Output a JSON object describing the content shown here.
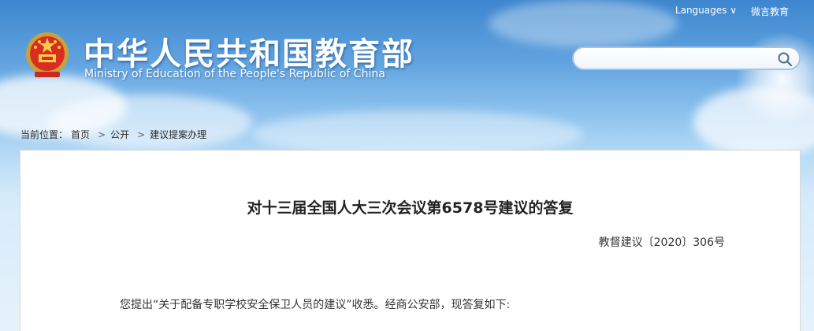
{
  "topbar": {
    "languages": "Languages ∨",
    "weibo": "微言教育"
  },
  "site": {
    "title_cn": "中华人民共和国教育部",
    "title_en": "Ministry of Education of the People's Republic of China"
  },
  "search": {
    "placeholder": "",
    "value": ""
  },
  "breadcrumb": {
    "prefix": "当前位置：",
    "items": [
      "首页",
      "公开",
      "建议提案办理"
    ],
    "separator": ">"
  },
  "document": {
    "title": "对十三届全国人大三次会议第6578号建议的答复",
    "number": "教督建议〔2020〕306号",
    "paragraph": "您提出“关于配备专职学校安全保卫人员的建议”收悉。经商公安部，现答复如下:"
  },
  "icons": {
    "emblem": "national-emblem-icon",
    "search": "search-icon"
  }
}
